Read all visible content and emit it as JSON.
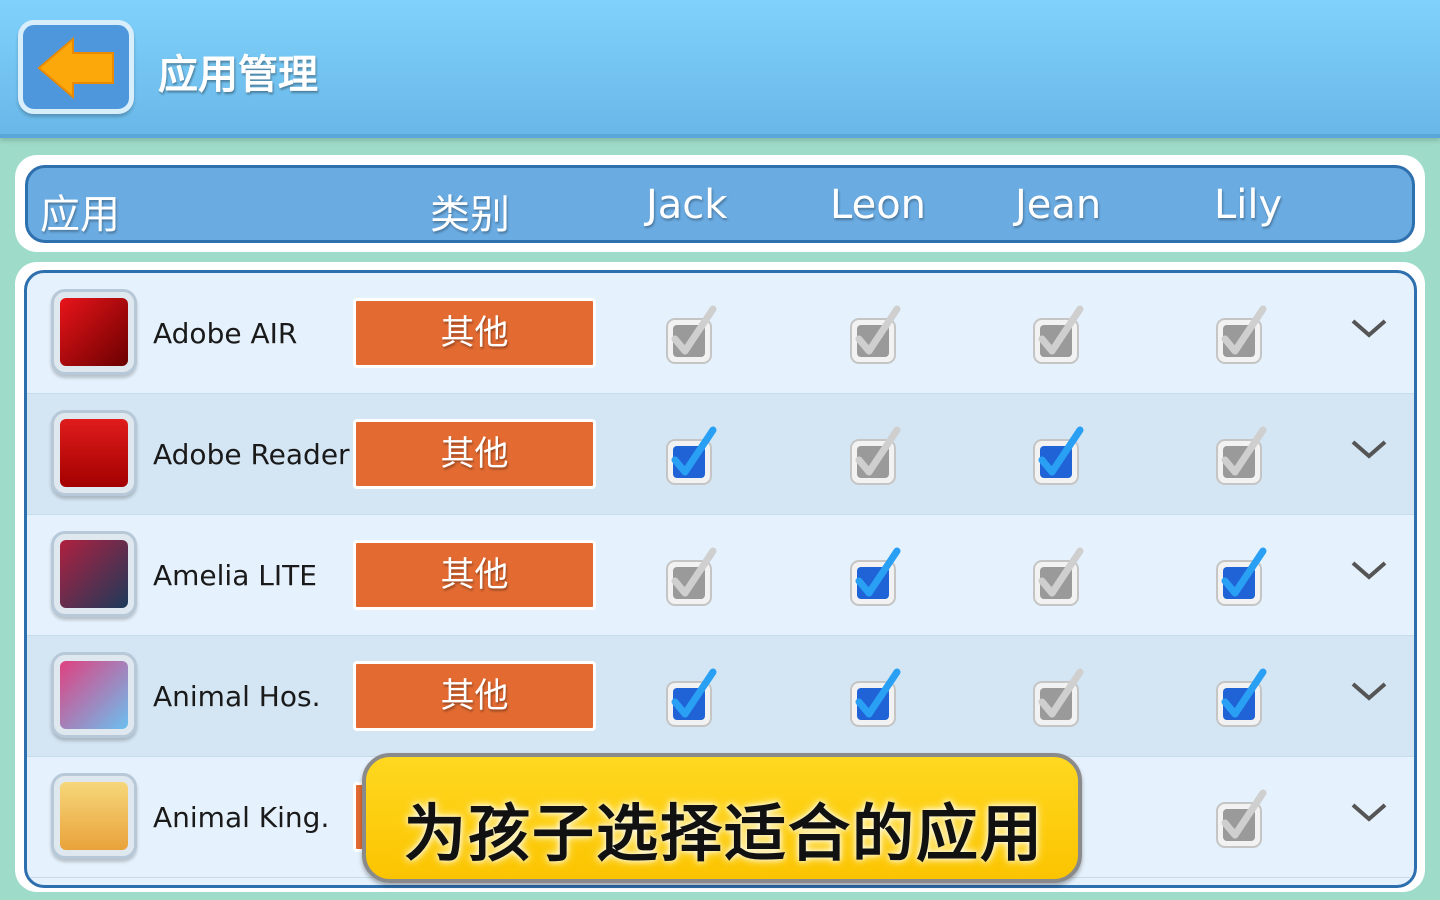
{
  "header": {
    "title": "应用管理",
    "back_icon": "arrow-left-icon"
  },
  "columns": {
    "app": "应用",
    "category": "类别",
    "users": [
      "Jack",
      "Leon",
      "Jean",
      "Lily"
    ]
  },
  "colors": {
    "checked": "#1f63d6",
    "unchecked": "#9a9a9a",
    "category": "#e36b32",
    "banner": "#ffd21a"
  },
  "rows": [
    {
      "name": "Adobe AIR",
      "category": "其他",
      "checks": [
        false,
        false,
        false,
        false
      ]
    },
    {
      "name": "Adobe Reader",
      "category": "其他",
      "checks": [
        true,
        false,
        true,
        false
      ]
    },
    {
      "name": "Amelia LITE",
      "category": "其他",
      "checks": [
        false,
        true,
        false,
        true
      ]
    },
    {
      "name": "Animal Hos.",
      "category": "其他",
      "checks": [
        true,
        true,
        false,
        true
      ]
    },
    {
      "name": "Animal King.",
      "category": null,
      "checks": [
        null,
        null,
        null,
        false
      ]
    }
  ],
  "banner": {
    "text": "为孩子选择适合的应用"
  }
}
